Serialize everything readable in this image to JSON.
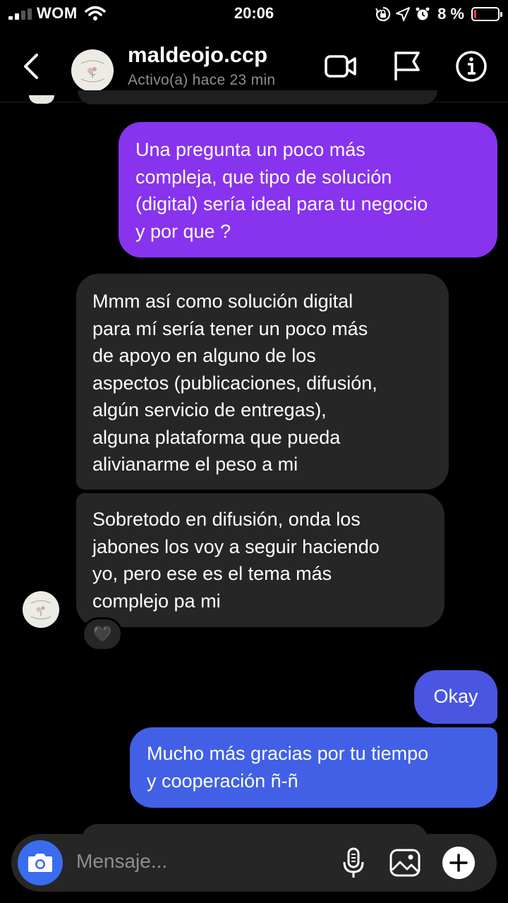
{
  "status_bar": {
    "carrier": "WOM",
    "time": "20:06",
    "battery_percent": "8 %",
    "battery_level": 0.08,
    "icons": [
      "signal-icon",
      "wifi-icon",
      "lock-rotation-icon",
      "location-icon",
      "alarm-icon",
      "battery-icon"
    ]
  },
  "header": {
    "username": "maldeojo.ccp",
    "status": "Activo(a) hace 23 min",
    "icons": [
      "back-chevron-icon",
      "video-call-icon",
      "flag-icon",
      "info-icon"
    ]
  },
  "messages": [
    {
      "direction": "outgoing",
      "text": "Una pregunta un poco más\ncompleja, que tipo de solución\n(digital) sería ideal para tu negocio\ny por que ?"
    },
    {
      "direction": "incoming",
      "text": "Mmm así como solución digital\npara mí sería tener un poco más\nde apoyo en alguno de los\naspectos (publicaciones, difusión,\nalgún servicio de entregas),\nalguna plataforma que pueda\nalivianarme el peso a mi"
    },
    {
      "direction": "incoming",
      "text": "Sobretodo en difusión, onda los\njabones los voy a seguir haciendo\nyo, pero ese es el tema más\ncomplejo pa mi",
      "reaction": "🖤"
    },
    {
      "direction": "outgoing",
      "text": "Okay"
    },
    {
      "direction": "outgoing",
      "text": "Mucho más gracias por tu tiempo\ny cooperación ñ-ñ"
    }
  ],
  "composer": {
    "placeholder": "Mensaje...",
    "icons": [
      "camera-icon",
      "microphone-icon",
      "gallery-icon",
      "plus-icon"
    ]
  },
  "colors": {
    "background": "#000000",
    "incoming_bubble": "#262626",
    "outgoing_purple": "#8833ee",
    "outgoing_indigo": "#4a56e2",
    "outgoing_blue": "#4160e6",
    "camera_button": "#3a6cf0",
    "secondary_text": "#8e8e8e"
  }
}
